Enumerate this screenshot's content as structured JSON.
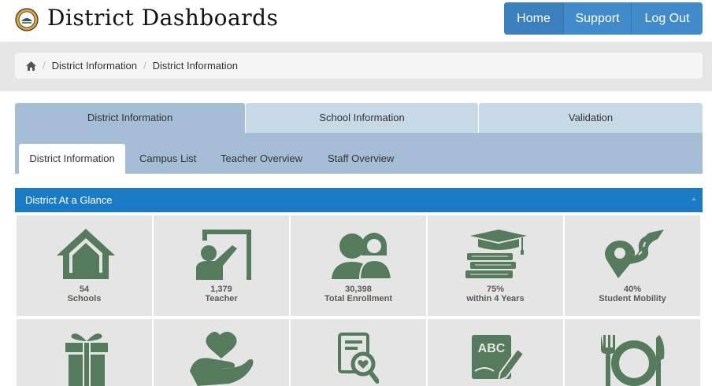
{
  "header": {
    "title": "District Dashboards",
    "nav": {
      "home": "Home",
      "support": "Support",
      "logout": "Log Out"
    }
  },
  "breadcrumb": {
    "items": [
      "District Information",
      "District Information"
    ]
  },
  "main_tabs": [
    "District Information",
    "School Information",
    "Validation"
  ],
  "sub_tabs": [
    "District Information",
    "Campus List",
    "Teacher Overview",
    "Staff Overview"
  ],
  "panel": {
    "title": "District At a Glance",
    "tiles": [
      {
        "value": "54",
        "caption": "Schools",
        "icon": "school-house-icon"
      },
      {
        "value": "1,379",
        "caption": "Teacher",
        "icon": "teacher-icon"
      },
      {
        "value": "30,398",
        "caption": "Total Enrollment",
        "icon": "enrollment-people-icon"
      },
      {
        "value": "75%",
        "caption": "within 4 Years",
        "icon": "graduation-icon"
      },
      {
        "value": "40%",
        "caption": "Student Mobility",
        "icon": "mobility-road-icon"
      }
    ],
    "row2_icons": [
      "gift-icon",
      "helping-hand-heart-icon",
      "document-search-icon",
      "abc-pencil-icon",
      "dining-plate-icon"
    ],
    "row2_icon_text": "ABC"
  },
  "colors": {
    "tile_icon": "#557a5c",
    "panel_header": "#1a7bc4",
    "nav_button": "#428bca",
    "tab_active": "#a5bed6",
    "tab_inactive": "#c7d8e6"
  }
}
